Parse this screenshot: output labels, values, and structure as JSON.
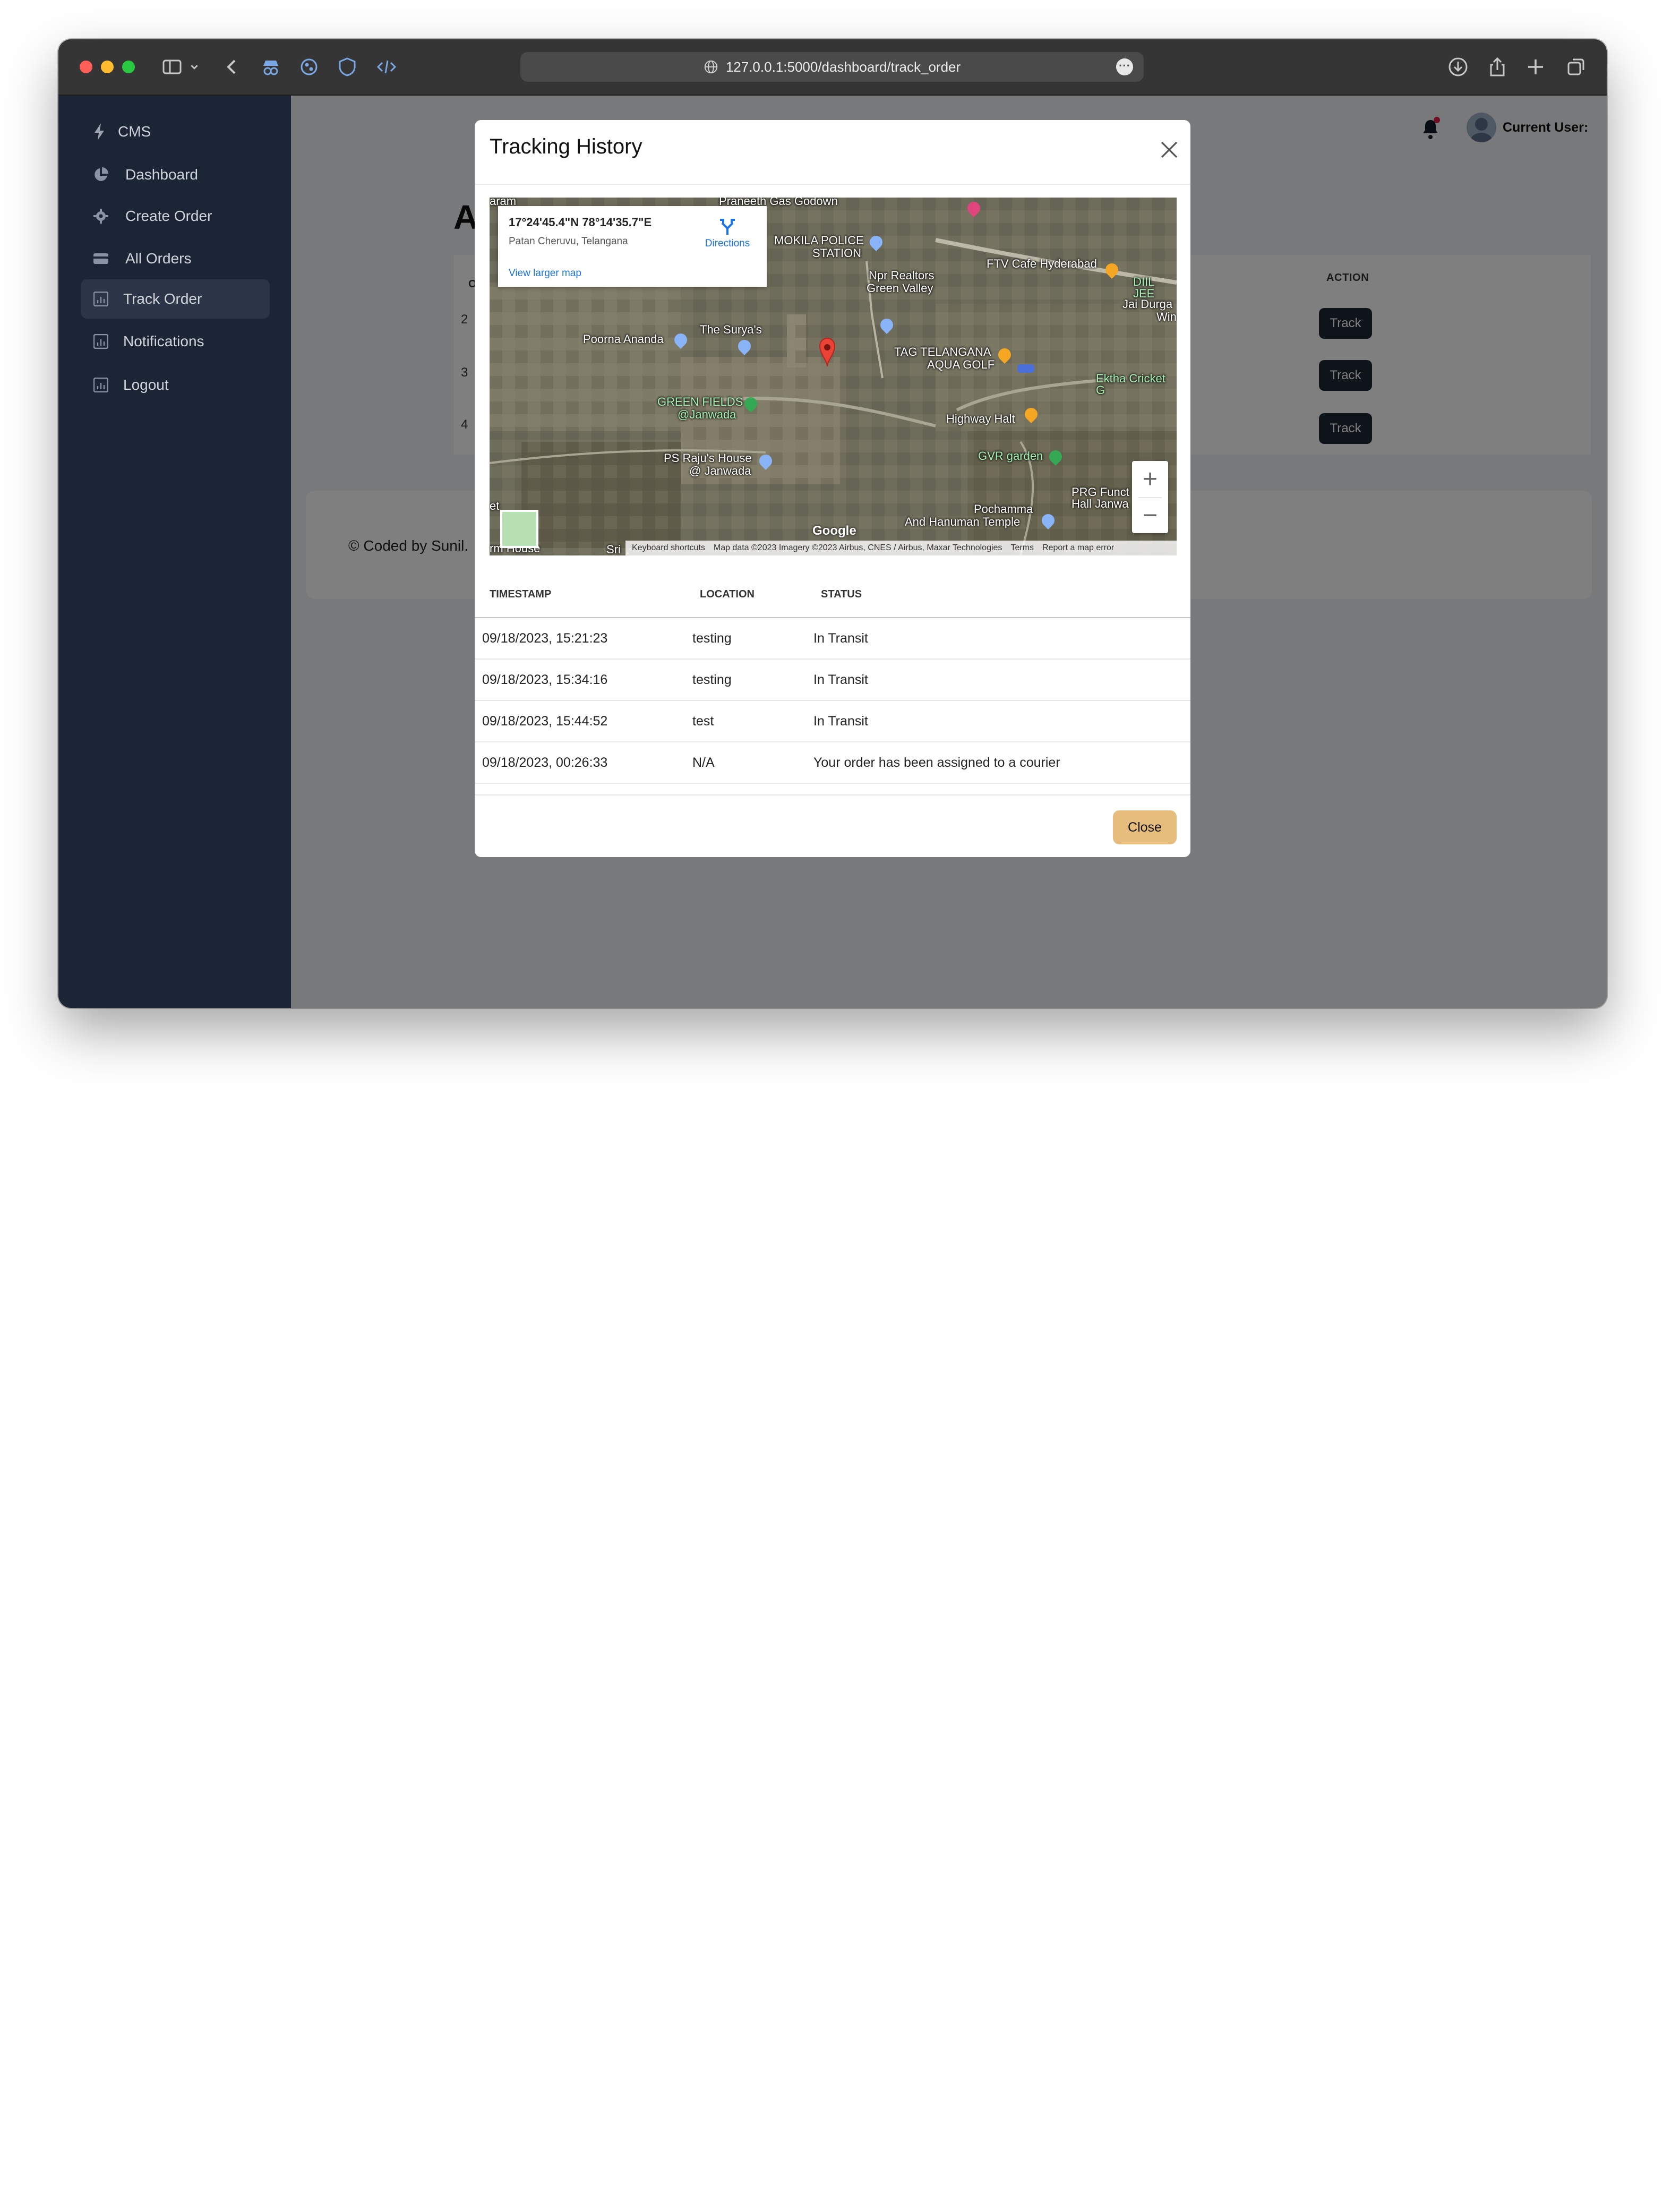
{
  "browser": {
    "url": "127.0.0.1:5000/dashboard/track_order"
  },
  "sidebar": {
    "brand": "CMS",
    "items": [
      {
        "label": "Dashboard",
        "icon": "pie-chart-icon"
      },
      {
        "label": "Create Order",
        "icon": "gear-icon"
      },
      {
        "label": "All Orders",
        "icon": "card-icon"
      },
      {
        "label": "Track Order",
        "icon": "bar-chart-icon",
        "active": true
      },
      {
        "label": "Notifications",
        "icon": "bar-chart-icon"
      },
      {
        "label": "Logout",
        "icon": "bar-chart-icon"
      }
    ]
  },
  "topbar": {
    "user_label": "Current User:"
  },
  "page": {
    "heading_partial": "A",
    "table_header_partial": "O",
    "action_header": "ACTION",
    "rows": [
      {
        "id": "2",
        "button": "Track"
      },
      {
        "id": "3",
        "button": "Track"
      },
      {
        "id": "4",
        "button": "Track"
      }
    ],
    "footer": "© Coded by Sunil."
  },
  "modal": {
    "title": "Tracking History",
    "map": {
      "coords": "17°24'45.4\"N 78°14'35.7\"E",
      "place": "Patan Cheruvu, Telangana",
      "directions": "Directions",
      "view_larger": "View larger map",
      "google": "Google",
      "attribution": {
        "keyboard": "Keyboard shortcuts",
        "map_data": "Map data ©2023 Imagery ©2023 Airbus, CNES / Airbus, Maxar Technologies",
        "terms": "Terms",
        "report": "Report a map error"
      },
      "labels": {
        "praneeth": "Praneeth Gas Godown",
        "mokila": "MOKILA POLICE",
        "station": "STATION",
        "ftv": "FTV Cafe Hyderabad",
        "diil": "DIIL JEE",
        "npr1": "Npr Realtors",
        "npr2": "Green Valley",
        "jai1": "Jai Durga",
        "jai2": "Win",
        "surya": "The Surya's",
        "poorna": "Poorna Ananda",
        "tag1": "TAG TELANGANA",
        "tag2": "AQUA GOLF",
        "ektha": "Ektha Cricket G",
        "green1": "GREEN FIELDS",
        "green2": "@Janwada",
        "highway": "Highway Halt",
        "psraju1": "PS Raju's House",
        "psraju2": "@ Janwada",
        "gvr": "GVR garden",
        "prg1": "PRG Funct",
        "prg2": "Hall Janwa",
        "pochamma1": "Pochamma",
        "pochamma2": "And Hanuman Temple",
        "farm": "rm House",
        "sri": "Sri",
        "aram": "aram",
        "et": "et"
      }
    },
    "table": {
      "headers": [
        "TIMESTAMP",
        "LOCATION",
        "STATUS"
      ],
      "rows": [
        {
          "timestamp": "09/18/2023, 15:21:23",
          "location": "testing",
          "status": "In Transit"
        },
        {
          "timestamp": "09/18/2023, 15:34:16",
          "location": "testing",
          "status": "In Transit"
        },
        {
          "timestamp": "09/18/2023, 15:44:52",
          "location": "test",
          "status": "In Transit"
        },
        {
          "timestamp": "09/18/2023, 00:26:33",
          "location": "N/A",
          "status": "Your order has been assigned to a courier"
        }
      ]
    },
    "close_button": "Close"
  }
}
